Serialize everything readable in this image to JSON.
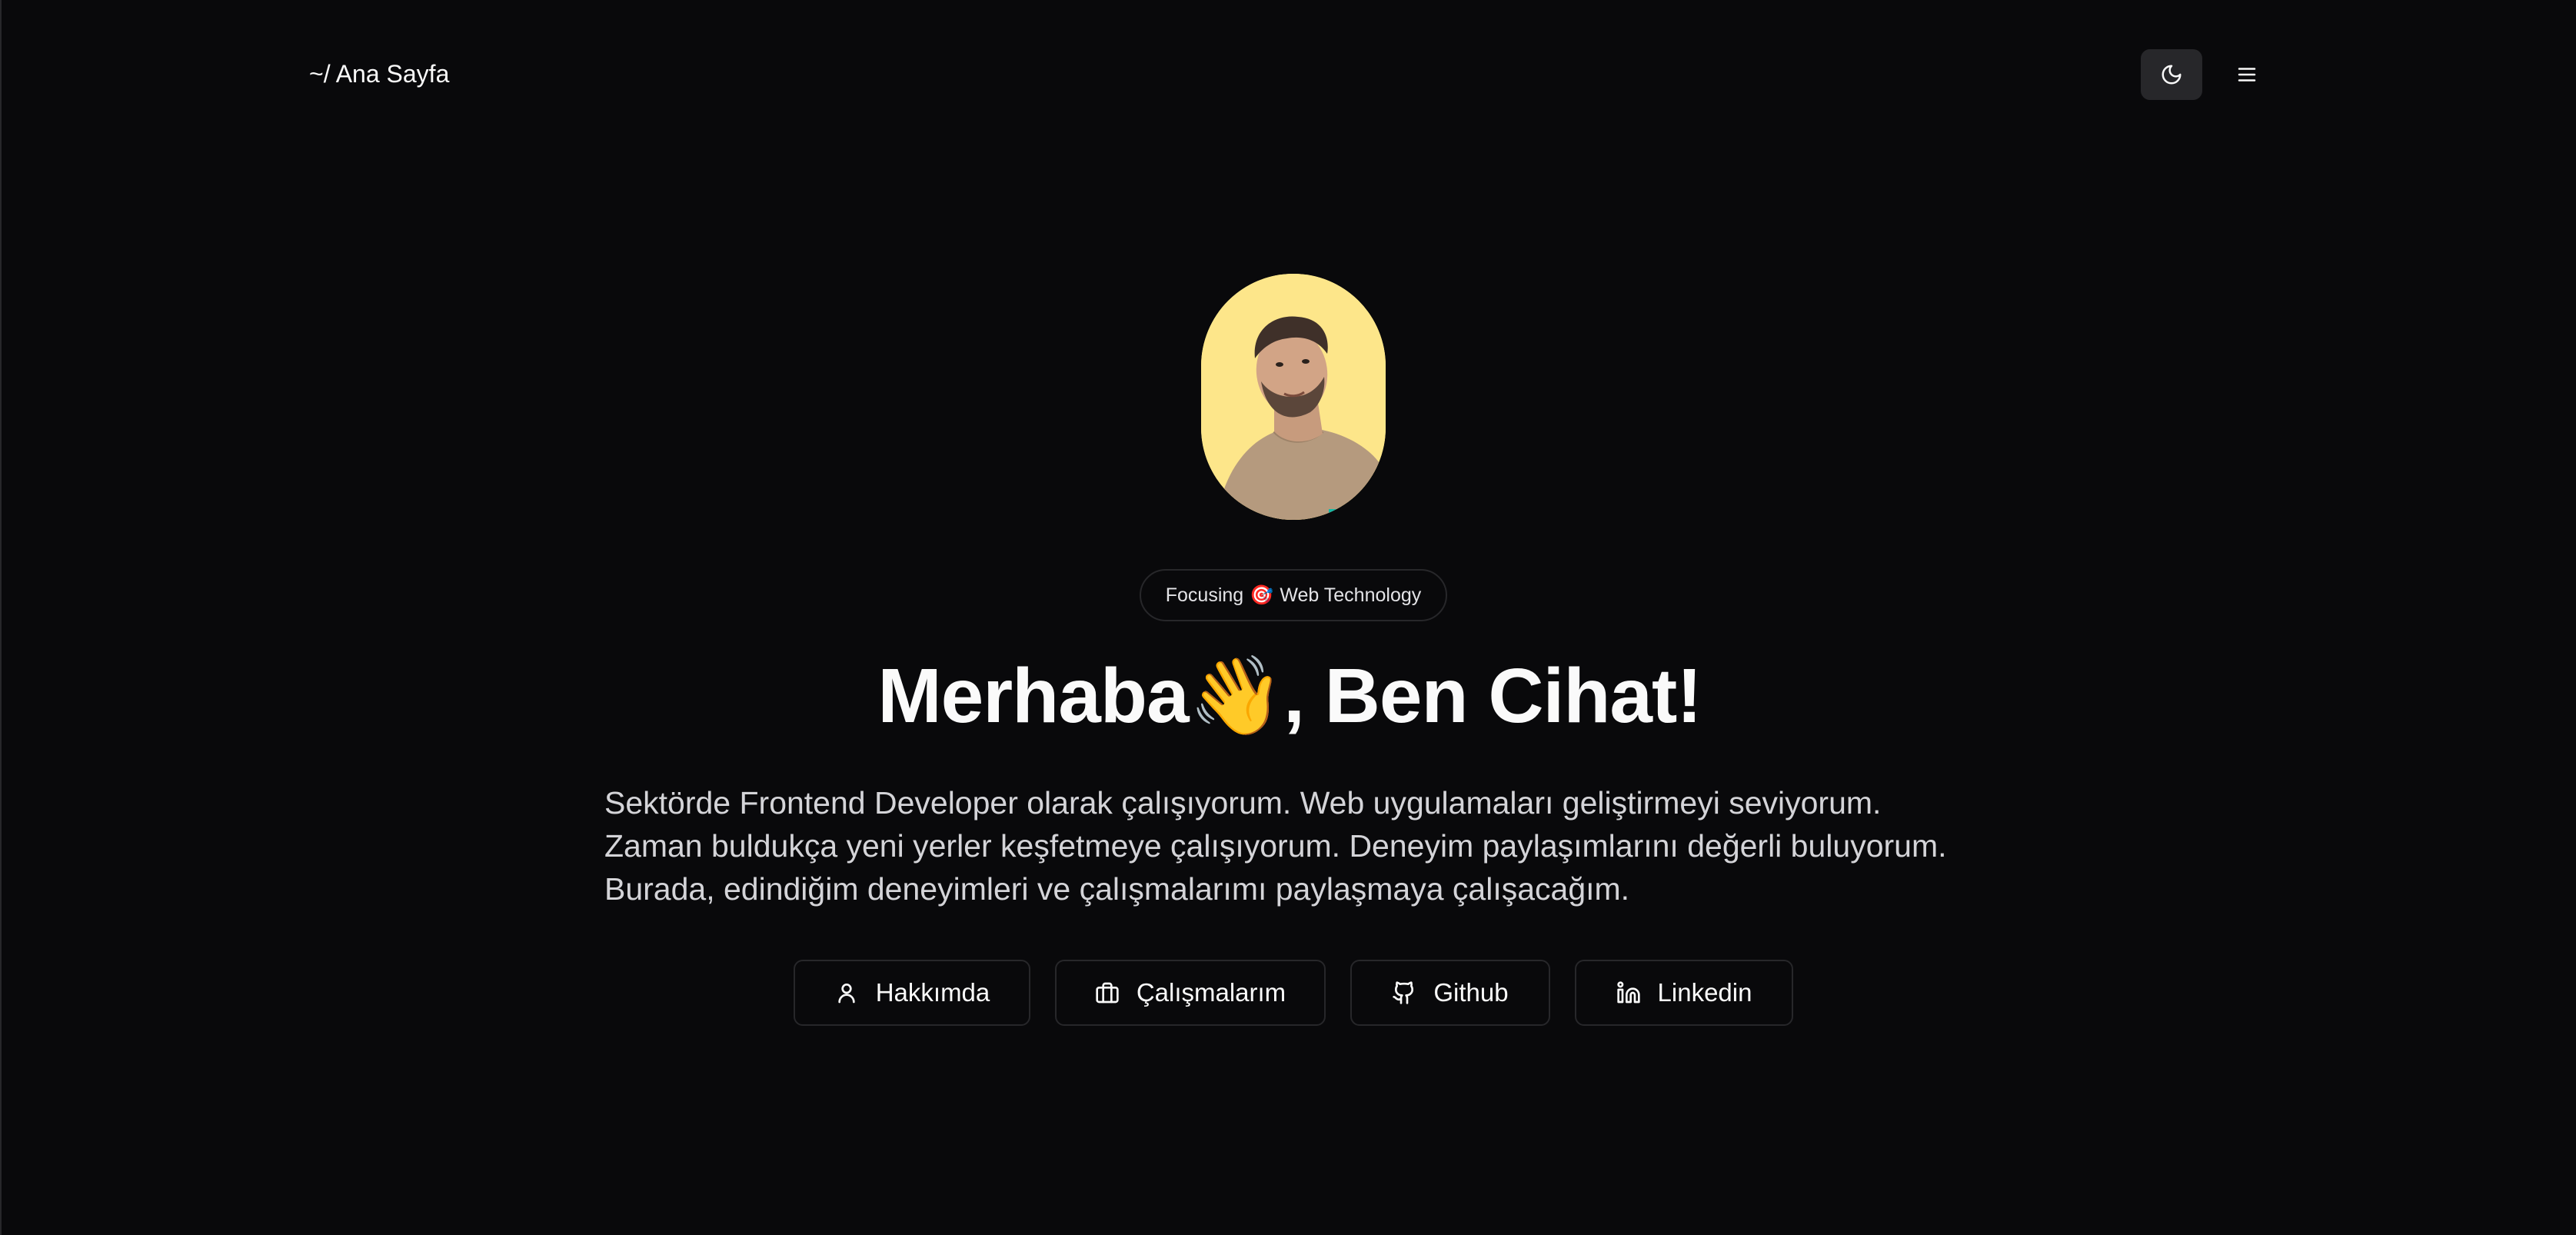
{
  "header": {
    "home_label": "~/ Ana Sayfa",
    "theme_toggle_icon": "moon-icon",
    "menu_icon": "menu-icon"
  },
  "hero": {
    "avatar_icon": "profile-photo",
    "badge": {
      "prefix": "Focusing",
      "emoji": "🎯",
      "suffix": "Web Technology"
    },
    "title": {
      "before": "Merhaba",
      "emoji": "👋",
      "after": ", Ben Cihat!"
    },
    "description": [
      "Sektörde Frontend Developer olarak çalışıyorum. Web uygulamaları geliştirmeyi seviyorum.",
      "Zaman buldukça yeni yerler keşfetmeye çalışıyorum. Deneyim paylaşımlarını değerli buluyorum.",
      "Burada, edindiğim deneyimleri ve çalışmalarımı paylaşmaya çalışacağım."
    ]
  },
  "actions": [
    {
      "label": "Hakkımda",
      "icon": "user-icon"
    },
    {
      "label": "Çalışmalarım",
      "icon": "briefcase-icon"
    },
    {
      "label": "Github",
      "icon": "github-icon"
    },
    {
      "label": "Linkedin",
      "icon": "linkedin-icon"
    }
  ],
  "colors": {
    "background": "#09090b",
    "border": "#27272a",
    "avatar_bg": "#fde68a",
    "text": "#fafafa"
  }
}
